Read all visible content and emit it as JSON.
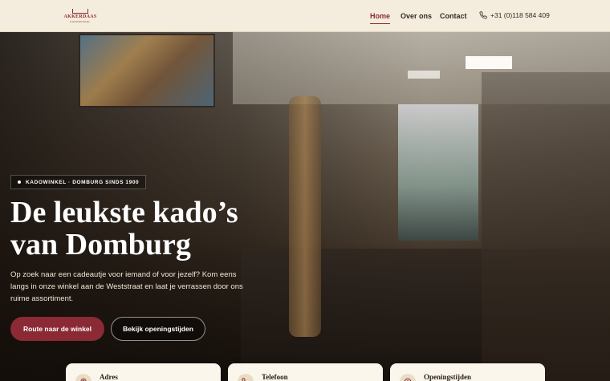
{
  "header": {
    "logo": {
      "name": "AKKERDAAS",
      "sub": "KADOWINKEL",
      "icon": "crown-logo"
    },
    "nav": [
      {
        "label": "Home",
        "active": true
      },
      {
        "label": "Over ons",
        "active": false
      },
      {
        "label": "Contact",
        "active": false
      }
    ],
    "phone": {
      "icon": "phone-icon",
      "label": "+31 (0)118 584 409"
    }
  },
  "hero": {
    "badge": "KADOWINKEL · DOMBURG SINDS 1900",
    "headline_line1": "De leukste kado’s",
    "headline_line2": "van Domburg",
    "lead": "Op zoek naar een cadeautje voor iemand of voor jezelf? Kom eens langs in onze winkel aan de Weststraat en laat je verrassen door ons ruime assortiment.",
    "primary_button": "Route naar de winkel",
    "secondary_button": "Bekijk openingstijden"
  },
  "cards": [
    {
      "icon": "map-pin-icon",
      "label": "Adres"
    },
    {
      "icon": "phone-icon",
      "label": "Telefoon"
    },
    {
      "icon": "clock-icon",
      "label": "Openingstijden"
    }
  ],
  "colors": {
    "accent": "#8b2a35",
    "background": "#f4ecdc"
  }
}
